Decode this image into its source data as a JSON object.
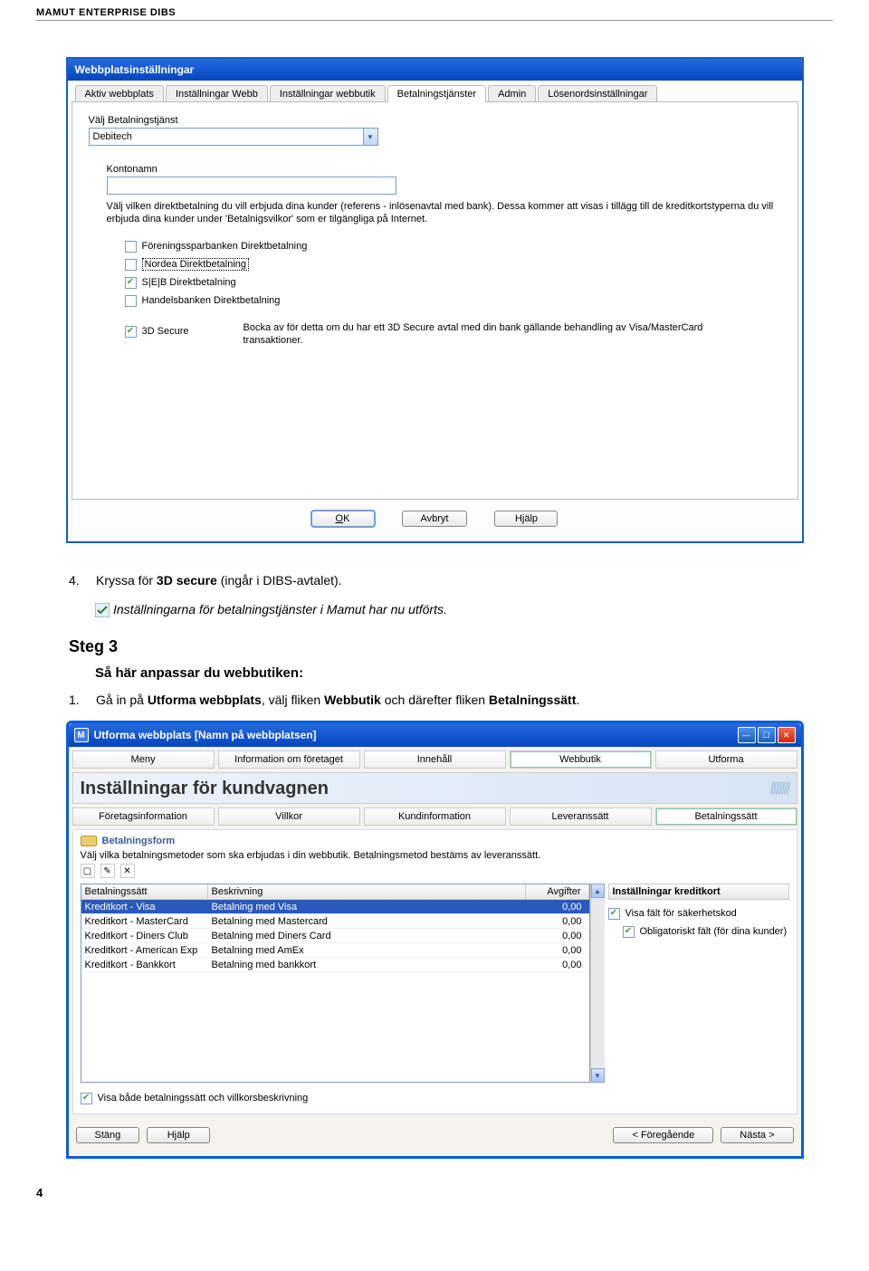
{
  "doc": {
    "header": "MAMUT ENTERPRISE DIBS",
    "page_number": "4",
    "step4_num": "4.",
    "step4_text_a": "Kryssa för ",
    "step4_text_b": "3D secure",
    "step4_text_c": " (ingår i DIBS-avtalet).",
    "note_text": "Inställningarna för betalningstjänster i Mamut har nu utförts.",
    "step3_heading": "Steg 3",
    "step3_sub": "Så här anpassar du webbutiken:",
    "step3_1_num": "1.",
    "step3_1_a": "Gå in på ",
    "step3_1_b": "Utforma webbplats",
    "step3_1_c": ", välj fliken ",
    "step3_1_d": "Webbutik",
    "step3_1_e": " och därefter fliken ",
    "step3_1_f": "Betalningssätt",
    "step3_1_g": "."
  },
  "dlg1": {
    "title": "Webbplatsinställningar",
    "tabs": [
      "Aktiv webbplats",
      "Inställningar Webb",
      "Inställningar webbutik",
      "Betalningstjänster",
      "Admin",
      "Lösenordsinställningar"
    ],
    "active_tab_index": 3,
    "field_label": "Välj Betalningstjänst",
    "dropdown_value": "Debitech",
    "kontonamn_label": "Kontonamn",
    "help_text": "Välj vilken direktbetalning du vill erbjuda dina kunder (referens - inlösenavtal med bank). Dessa kommer att visas i tillägg till de kreditkortstyperna du vill erbjuda dina kunder under 'Betalnigsvilkor' som er tilgängliga på Internet.",
    "checks": [
      {
        "label": "Föreningssparbanken Direktbetalning",
        "checked": false,
        "selected": false
      },
      {
        "label": "Nordea Direktbetalning",
        "checked": false,
        "selected": true
      },
      {
        "label": "S|E|B Direktbetalning",
        "checked": true,
        "selected": false
      },
      {
        "label": "Handelsbanken Direktbetalning",
        "checked": false,
        "selected": false
      }
    ],
    "secure_label": "3D Secure",
    "secure_checked": true,
    "secure_note": "Bocka av för detta om du har ett 3D Secure avtal med din bank gällande behandling av Visa/MasterCard transaktioner.",
    "buttons": {
      "ok": "OK",
      "cancel": "Avbryt",
      "help": "Hjälp"
    }
  },
  "dlg2": {
    "title": "Utforma webbplats [Namn på webbplatsen]",
    "toptabs": [
      "Meny",
      "Information om företaget",
      "Innehåll",
      "Webbutik",
      "Utforma"
    ],
    "toptab_active_index": 3,
    "section_title": "Inställningar för kundvagnen",
    "subtabs": [
      "Företagsinformation",
      "Villkor",
      "Kundinformation",
      "Leveranssätt",
      "Betalningssätt"
    ],
    "subtab_active_index": 4,
    "form_title": "Betalningsform",
    "form_help": "Välj vilka betalningsmetoder som ska erbjudas i din webbutik. Betalningsmetod bestäms av leveranssätt.",
    "grid": {
      "headers": [
        "Betalningssätt",
        "Beskrivning",
        "Avgifter"
      ],
      "rows": [
        {
          "c0": "Kreditkort - Visa",
          "c1": "Betalning med Visa",
          "c2": "0,00",
          "selected": true
        },
        {
          "c0": "Kreditkort - MasterCard",
          "c1": "Betalning med Mastercard",
          "c2": "0,00",
          "selected": false
        },
        {
          "c0": "Kreditkort - Diners Club",
          "c1": "Betalning med Diners Card",
          "c2": "0,00",
          "selected": false
        },
        {
          "c0": "Kreditkort - American Exp",
          "c1": "Betalning med AmEx",
          "c2": "0,00",
          "selected": false
        },
        {
          "c0": "Kreditkort - Bankkort",
          "c1": "Betalning med bankkort",
          "c2": "0,00",
          "selected": false
        }
      ]
    },
    "right_header": "Inställningar kreditkort",
    "right_checks": [
      {
        "label": "Visa fält för säkerhetskod",
        "checked": true,
        "indent": 0
      },
      {
        "label": "Obligatoriskt fält (för dina kunder)",
        "checked": true,
        "indent": 1
      }
    ],
    "below_check": {
      "label": "Visa både betalningssätt och villkorsbeskrivning",
      "checked": true
    },
    "buttons": {
      "close": "Stäng",
      "help": "Hjälp",
      "prev": "<  Föregående",
      "next": "Nästa >"
    }
  }
}
